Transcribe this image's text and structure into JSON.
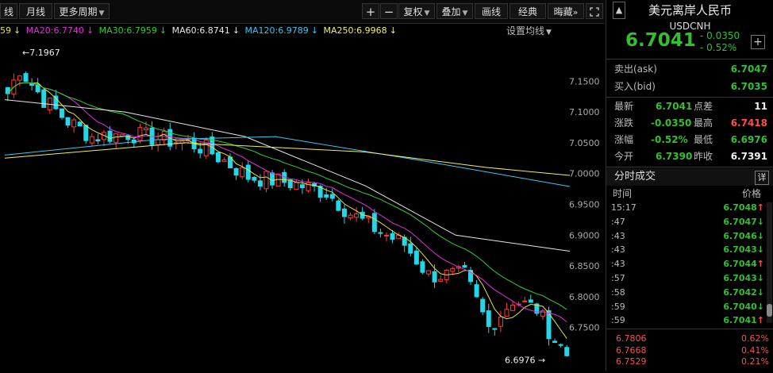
{
  "toolbar": {
    "tabs": [
      "线",
      "月线",
      "更多周期"
    ],
    "plus": "+",
    "minus": "−",
    "fuquan": "复权",
    "diejia": "叠加",
    "huaxian": "画线",
    "jingdian": "经典",
    "huicang": "晦藏",
    "expand": "»"
  },
  "ma_legend": {
    "ma_first": "59",
    "ma20": "MA20:6.7740",
    "ma30": "MA30:6.7959",
    "ma60": "MA60:6.8741",
    "ma120": "MA120:6.9789",
    "ma250": "MA250:6.9968",
    "settings": "设置均线"
  },
  "colors": {
    "ma5": "#ffffff",
    "ma10": "#e8e04a",
    "ma20": "#e02ee0",
    "ma30": "#2fd02f",
    "ma60": "#e6e6e6",
    "ma120": "#3ac8f0",
    "ma250": "#f0f060",
    "up": "#ff3a3a",
    "down": "#22d8e8",
    "green": "#31c031",
    "red": "#ff4d4d"
  },
  "chart_data": {
    "type": "candlestick",
    "title": "",
    "ylim": [
      6.68,
      7.22
    ],
    "yticks": [
      "7.1500",
      "7.1000",
      "7.0500",
      "7.0000",
      "6.9500",
      "6.9000",
      "6.8500",
      "6.8000",
      "6.7500"
    ],
    "annotations": {
      "high": "7.1967",
      "low": "6.6976"
    },
    "last_close": 6.7041
  },
  "panel": {
    "title": "美元离岸人民币",
    "code": "USDCNH",
    "price": "6.7041",
    "change": "- 0.0350",
    "change_pct": "- 0.52%",
    "add_btn": "+",
    "ask_label": "卖出(ask)",
    "ask": "6.7047",
    "bid_label": "买入(bid)",
    "bid": "6.7035",
    "latest_label": "最新",
    "latest": "6.7041",
    "spread_label": "点差",
    "spread": "11",
    "zhangdie_label": "涨跌",
    "zhangdie": "-0.0350",
    "high_label": "最高",
    "high": "6.7418",
    "zhangfu_label": "涨幅",
    "zhangfu": "-0.52%",
    "low_label": "最低",
    "low": "6.6976",
    "open_label": "今开",
    "open": "6.7390",
    "prev_label": "昨收",
    "prev": "6.7391",
    "ticks_title": "分时成交",
    "detail_btn": "详",
    "time_header": "时间",
    "price_header": "价格",
    "ticks": [
      {
        "t": "15:17",
        "p": "6.7048",
        "dir": "↑",
        "up": true
      },
      {
        "t": ":47",
        "p": "6.7047",
        "dir": "↓",
        "up": false
      },
      {
        "t": ":43",
        "p": "6.7046",
        "dir": "↓",
        "up": false
      },
      {
        "t": ":43",
        "p": "6.7043",
        "dir": "↓",
        "up": false
      },
      {
        "t": ":43",
        "p": "6.7044",
        "dir": "↑",
        "up": true
      },
      {
        "t": ":57",
        "p": "6.7043",
        "dir": "↓",
        "up": false
      },
      {
        "t": ":58",
        "p": "6.7042",
        "dir": "↓",
        "up": false
      },
      {
        "t": ":59",
        "p": "6.7040",
        "dir": "↓",
        "up": false
      },
      {
        "t": ":59",
        "p": "6.7041",
        "dir": "↑",
        "up": true
      }
    ],
    "mini": [
      {
        "price": "6.7806",
        "pct": "0.62%"
      },
      {
        "price": "6.7668",
        "pct": "0.41%"
      },
      {
        "price": "6.7529",
        "pct": "0.21%"
      }
    ]
  }
}
